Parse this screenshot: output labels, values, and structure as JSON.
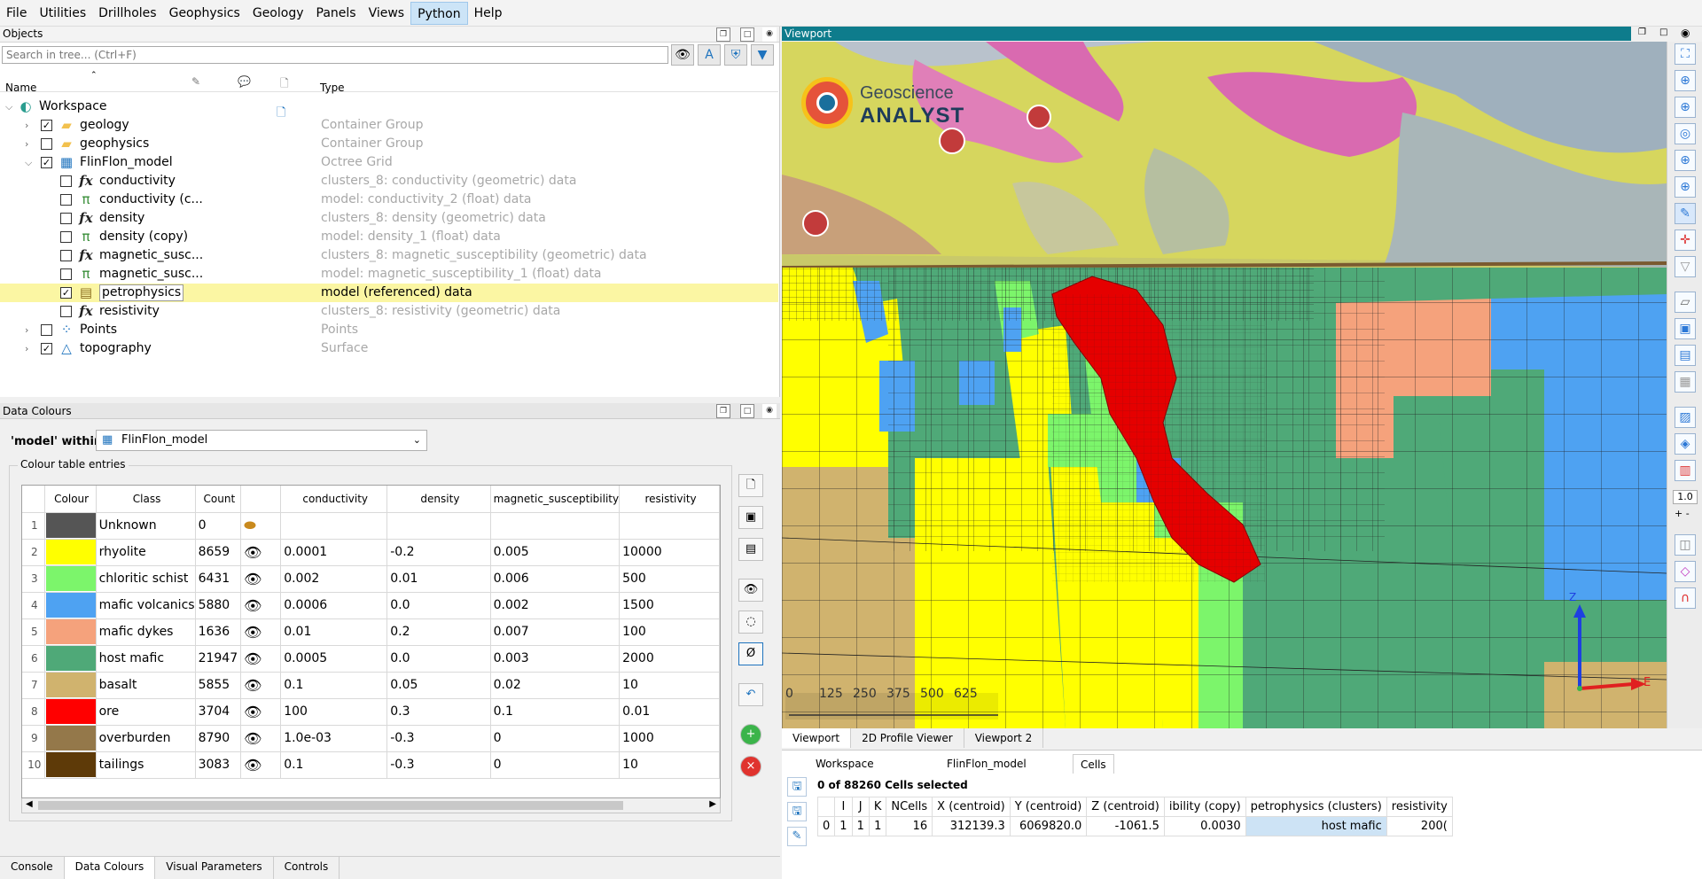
{
  "menu": [
    "File",
    "Utilities",
    "Drillholes",
    "Geophysics",
    "Geology",
    "Panels",
    "Views",
    "Python",
    "Help"
  ],
  "menu_active": "Python",
  "objects": {
    "title": "Objects",
    "search_placeholder": "Search in tree... (Ctrl+F)",
    "header": {
      "name": "Name",
      "type": "Type"
    },
    "rows": [
      {
        "name": "Workspace",
        "type": "",
        "icon": "workspace-icon",
        "level": 0,
        "expand": "open",
        "checkbox": null
      },
      {
        "name": "geology",
        "type": "Container Group",
        "icon": "folder-icon",
        "level": 1,
        "expand": "closed",
        "checkbox": true
      },
      {
        "name": "geophysics",
        "type": "Container Group",
        "icon": "folder-icon",
        "level": 1,
        "expand": "closed",
        "checkbox": false
      },
      {
        "name": "FlinFlon_model",
        "type": "Octree Grid",
        "icon": "octree-icon",
        "level": 1,
        "expand": "open",
        "checkbox": true
      },
      {
        "name": "conductivity",
        "type": "clusters_8: conductivity (geometric) data",
        "icon": "fx-icon",
        "level": 2,
        "expand": null,
        "checkbox": false
      },
      {
        "name": "conductivity (c...",
        "type": "model: conductivity_2 (float) data",
        "icon": "pi-icon",
        "level": 2,
        "expand": null,
        "checkbox": false
      },
      {
        "name": "density",
        "type": "clusters_8: density (geometric) data",
        "icon": "fx-icon",
        "level": 2,
        "expand": null,
        "checkbox": false
      },
      {
        "name": "density (copy)",
        "type": "model: density_1 (float) data",
        "icon": "pi-icon",
        "level": 2,
        "expand": null,
        "checkbox": false
      },
      {
        "name": "magnetic_susc...",
        "type": "clusters_8: magnetic_susceptibility (geometric) data",
        "icon": "fx-icon",
        "level": 2,
        "expand": null,
        "checkbox": false
      },
      {
        "name": "magnetic_susc...",
        "type": "model: magnetic_susceptibility_1 (float) data",
        "icon": "pi-icon",
        "level": 2,
        "expand": null,
        "checkbox": false
      },
      {
        "name": "petrophysics",
        "type": "model (referenced) data",
        "icon": "referenced-icon",
        "level": 2,
        "expand": null,
        "checkbox": true,
        "selected": true
      },
      {
        "name": "resistivity",
        "type": "clusters_8: resistivity (geometric) data",
        "icon": "fx-icon",
        "level": 2,
        "expand": null,
        "checkbox": false
      },
      {
        "name": "Points",
        "type": "Points",
        "icon": "points-icon",
        "level": 1,
        "expand": "closed",
        "checkbox": false
      },
      {
        "name": "topography",
        "type": "Surface",
        "icon": "surface-icon",
        "level": 1,
        "expand": "closed",
        "checkbox": true
      }
    ]
  },
  "data_colours": {
    "title": "Data Colours",
    "within_label": "'model' within",
    "within_value": "FlinFlon_model",
    "group_label": "Colour table entries",
    "columns": [
      "Colour",
      "Class",
      "Count",
      "",
      "conductivity",
      "density",
      "magnetic_susceptibility",
      "resistivity"
    ],
    "rows": [
      {
        "n": "1",
        "color": "#555555",
        "class": "Unknown",
        "count": "0",
        "eye": "hidden",
        "conductivity": "",
        "density": "",
        "mag": "",
        "res": ""
      },
      {
        "n": "2",
        "color": "#ffff00",
        "class": "rhyolite",
        "count": "8659",
        "eye": "visible",
        "conductivity": "0.0001",
        "density": "-0.2",
        "mag": "0.005",
        "res": "10000"
      },
      {
        "n": "3",
        "color": "#7cf56b",
        "class": "chloritic schist",
        "count": "6431",
        "eye": "visible",
        "conductivity": "0.002",
        "density": "0.01",
        "mag": "0.006",
        "res": "500"
      },
      {
        "n": "4",
        "color": "#4ea2f2",
        "class": "mafic volcanics",
        "count": "5880",
        "eye": "visible",
        "conductivity": "0.0006",
        "density": "0.0",
        "mag": "0.002",
        "res": "1500"
      },
      {
        "n": "5",
        "color": "#f5a27c",
        "class": "mafic dykes",
        "count": "1636",
        "eye": "visible",
        "conductivity": "0.01",
        "density": "0.2",
        "mag": "0.007",
        "res": "100"
      },
      {
        "n": "6",
        "color": "#4fa978",
        "class": "host mafic",
        "count": "21947",
        "eye": "visible",
        "conductivity": "0.0005",
        "density": "0.0",
        "mag": "0.003",
        "res": "2000"
      },
      {
        "n": "7",
        "color": "#d0b36e",
        "class": "basalt",
        "count": "5855",
        "eye": "visible",
        "conductivity": "0.1",
        "density": "0.05",
        "mag": "0.02",
        "res": "10"
      },
      {
        "n": "8",
        "color": "#ff0000",
        "class": "ore",
        "count": "3704",
        "eye": "visible",
        "conductivity": "100",
        "density": "0.3",
        "mag": "0.1",
        "res": "0.01"
      },
      {
        "n": "9",
        "color": "#94784a",
        "class": "overburden",
        "count": "8790",
        "eye": "visible",
        "conductivity": "1.0e-03",
        "density": "-0.3",
        "mag": "0",
        "res": "1000"
      },
      {
        "n": "10",
        "color": "#5e3a08",
        "class": "tailings",
        "count": "3083",
        "eye": "visible",
        "conductivity": "0.1",
        "density": "-0.3",
        "mag": "0",
        "res": "10"
      }
    ]
  },
  "bottom_tabs": [
    "Console",
    "Data Colours",
    "Visual Parameters",
    "Controls"
  ],
  "bottom_tab_active": "Data Colours",
  "viewport": {
    "title": "Viewport",
    "logo_line1": "Geoscience",
    "logo_line2": "ANALYST",
    "scale_labels": [
      "0",
      "125",
      "250",
      "375",
      "500",
      "625"
    ],
    "axis_z": "Z",
    "axis_e": "E",
    "zoom_value": "1.0"
  },
  "viewport_tabs": [
    "Viewport",
    "2D Profile Viewer",
    "Viewport 2"
  ],
  "viewport_tab_active": "Viewport",
  "cells_panel": {
    "tabs": [
      "Workspace",
      "FlinFlon_model",
      "Cells"
    ],
    "active": "Cells",
    "selected_info": "0 of 88260 Cells selected",
    "columns": [
      "I",
      "J",
      "K",
      "NCells",
      "X (centroid)",
      "Y (centroid)",
      "Z (centroid)",
      "ibility (copy)",
      "petrophysics (clusters)",
      "resistivity"
    ],
    "rows": [
      {
        "idx": "0",
        "I": "1",
        "J": "1",
        "K": "1",
        "NCells": "16",
        "X": "312139.3",
        "Y": "6069820.0",
        "Z": "-1061.5",
        "mag": "0.0030",
        "petro": "host mafic",
        "res": "200("
      }
    ]
  },
  "colors": {
    "accent": "#0e7c8c",
    "selected_row": "#fbf6a3",
    "ore": "#ff0000"
  }
}
